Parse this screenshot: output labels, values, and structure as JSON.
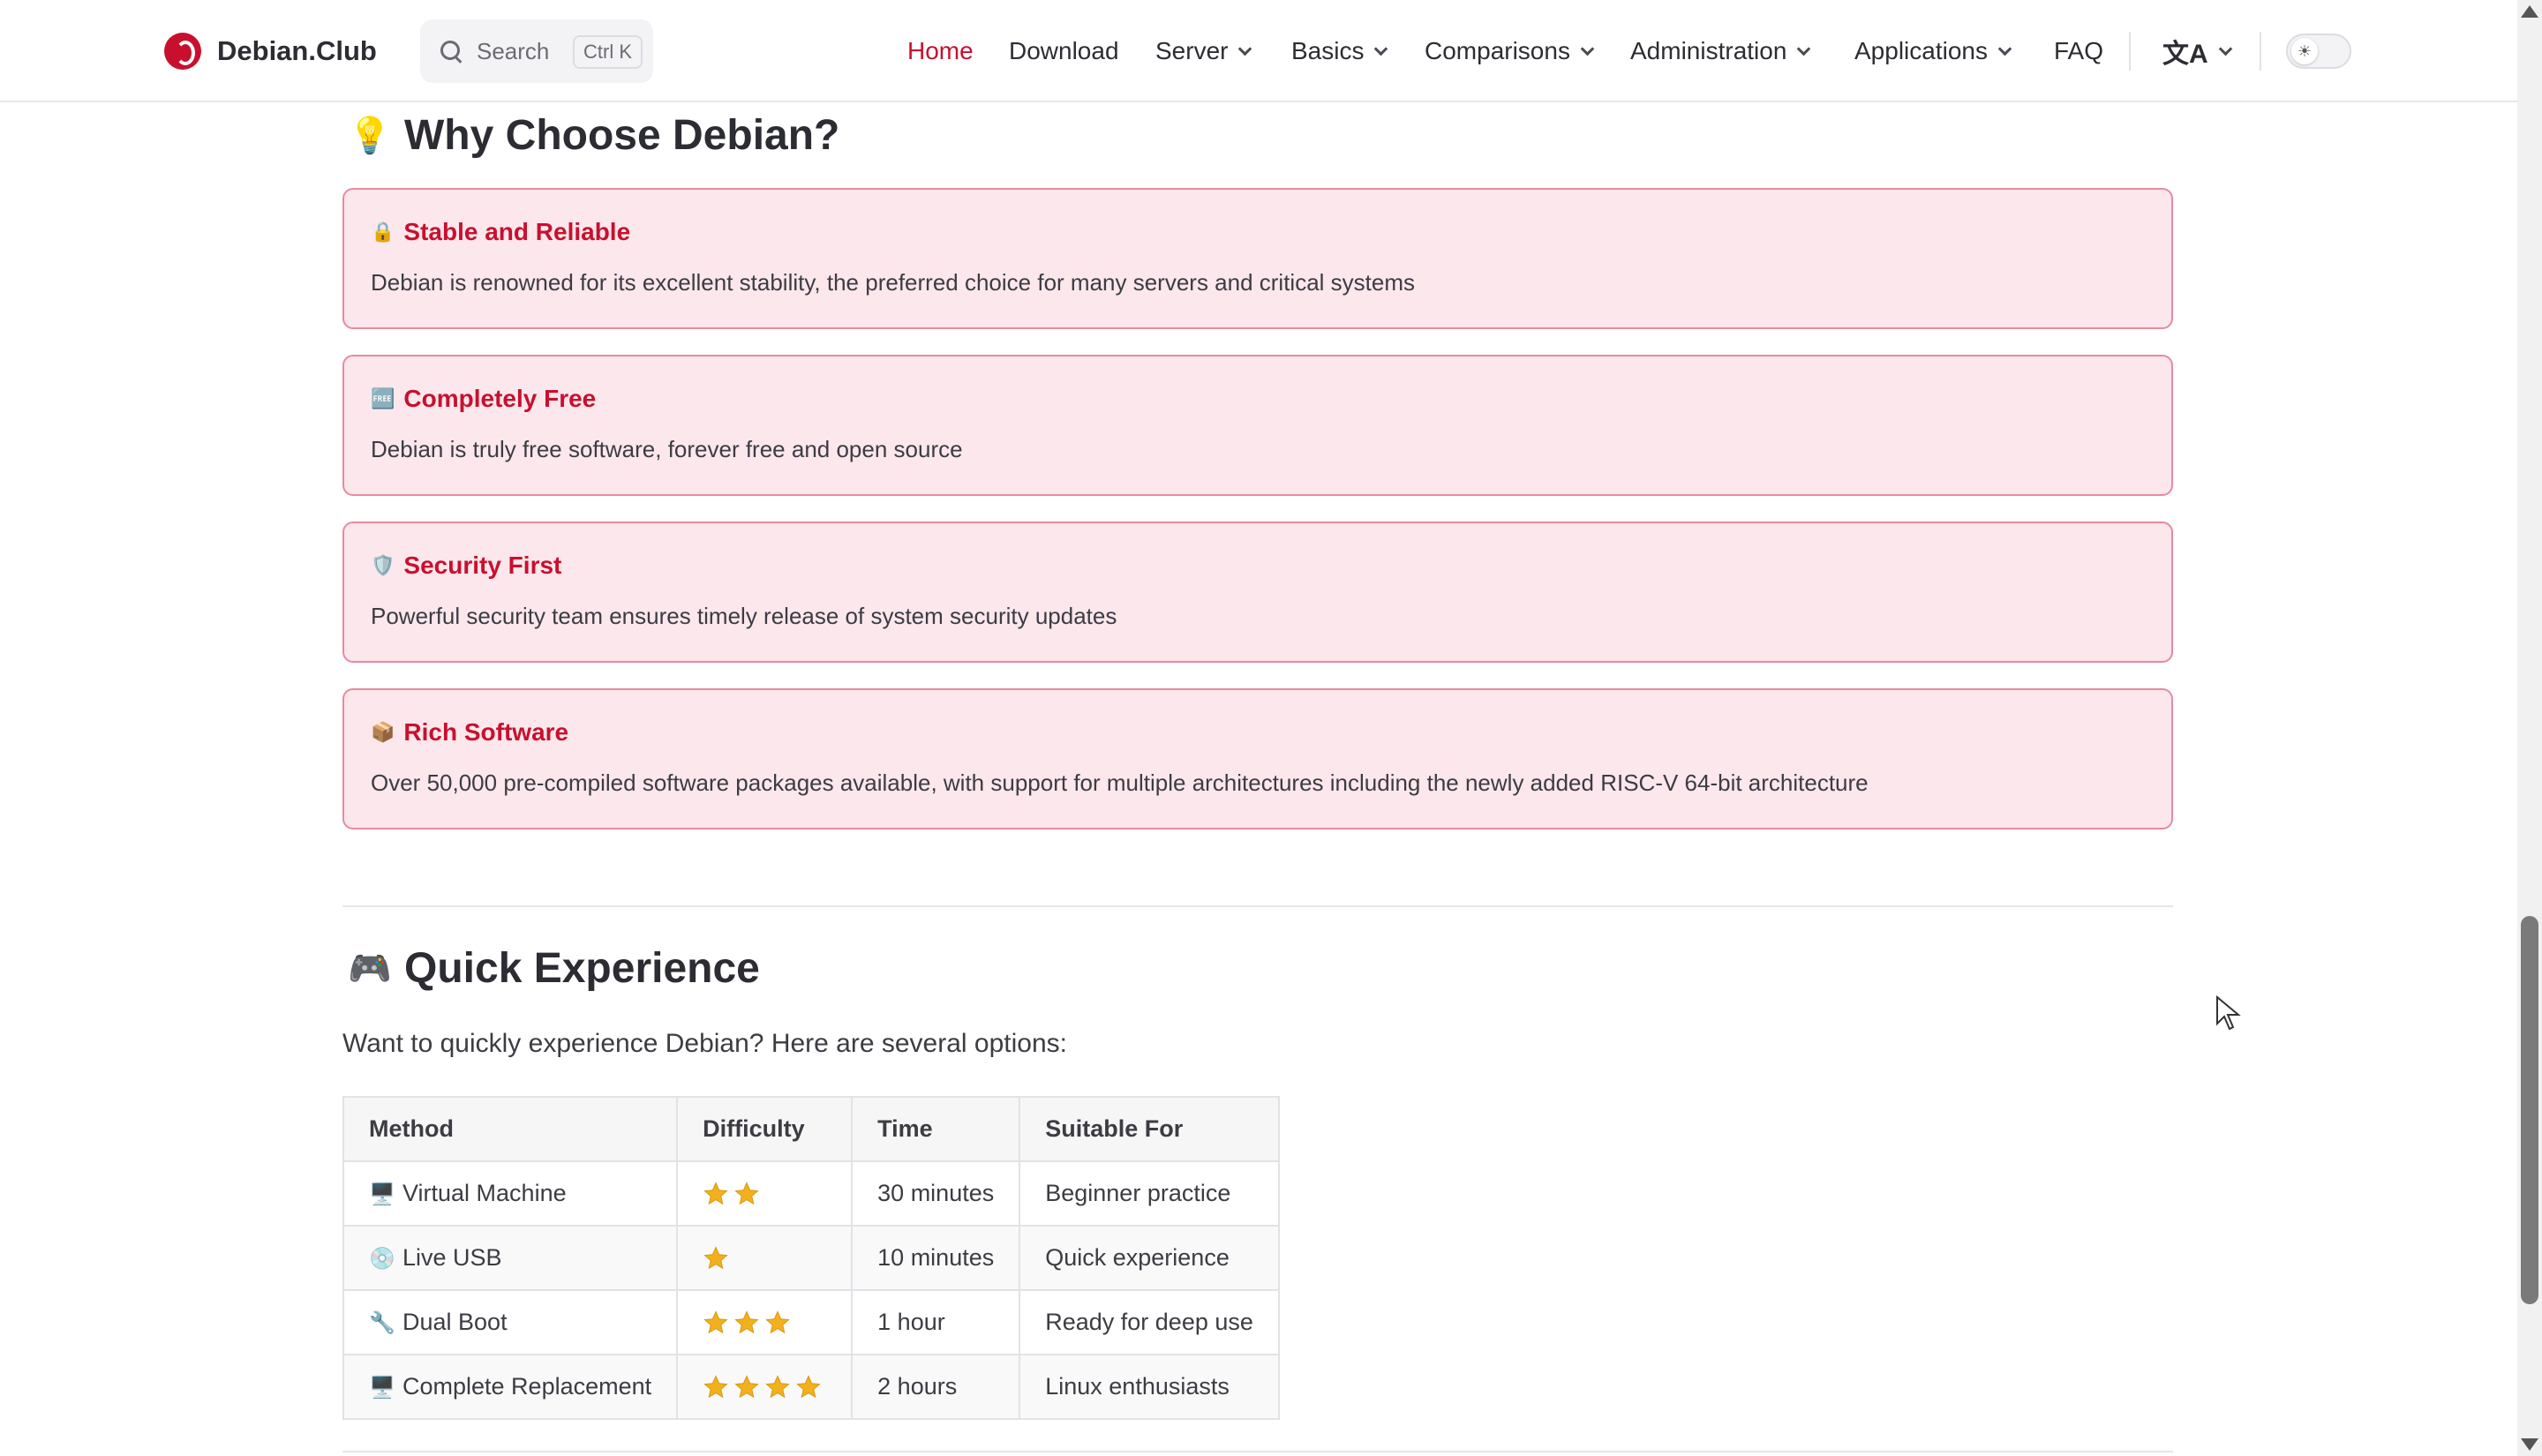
{
  "brand": {
    "name": "Debian.Club"
  },
  "search": {
    "label": "Search",
    "shortcut": "Ctrl K"
  },
  "nav": {
    "home": "Home",
    "download": "Download",
    "server": "Server",
    "basics": "Basics",
    "comparisons": "Comparisons",
    "administration": "Administration",
    "applications": "Applications",
    "faq": "FAQ"
  },
  "colors": {
    "accent": "#c8102e",
    "card_bg": "#fbe7ec",
    "card_border": "#e88aa0",
    "star": "#f2b01e"
  },
  "why": {
    "emoji": "💡",
    "heading": "Why Choose Debian?",
    "cards": [
      {
        "emoji": "🔒",
        "title": "Stable and Reliable",
        "desc": "Debian is renowned for its excellent stability, the preferred choice for many servers and critical systems"
      },
      {
        "emoji": "🆓",
        "title": "Completely Free",
        "desc": "Debian is truly free software, forever free and open source"
      },
      {
        "emoji": "🛡️",
        "title": "Security First",
        "desc": "Powerful security team ensures timely release of system security updates"
      },
      {
        "emoji": "📦",
        "title": "Rich Software",
        "desc": "Over 50,000 pre-compiled software packages available, with support for multiple architectures including the newly added RISC-V 64-bit architecture"
      }
    ]
  },
  "quick": {
    "emoji": "🎮",
    "heading": "Quick Experience",
    "intro": "Want to quickly experience Debian? Here are several options:",
    "columns": [
      "Method",
      "Difficulty",
      "Time",
      "Suitable For"
    ],
    "rows": [
      {
        "emoji": "🖥️",
        "method": "Virtual Machine",
        "stars": 2,
        "time": "30 minutes",
        "suitable": "Beginner practice"
      },
      {
        "emoji": "💿",
        "method": "Live USB",
        "stars": 1,
        "time": "10 minutes",
        "suitable": "Quick experience"
      },
      {
        "emoji": "🔧",
        "method": "Dual Boot",
        "stars": 3,
        "time": "1 hour",
        "suitable": "Ready for deep use"
      },
      {
        "emoji": "🖥️",
        "method": "Complete Replacement",
        "stars": 4,
        "time": "2 hours",
        "suitable": "Linux enthusiasts"
      }
    ]
  }
}
